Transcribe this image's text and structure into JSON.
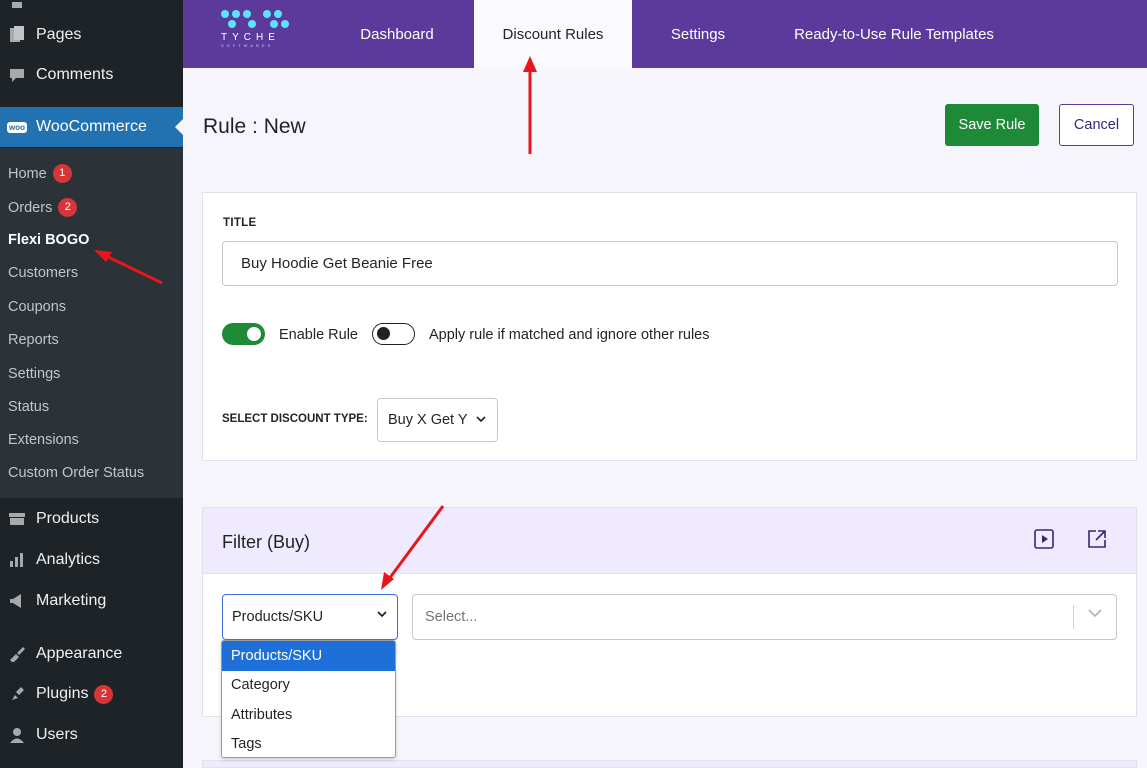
{
  "sidebar": {
    "menu": [
      {
        "label": "Pages",
        "icon": "pages-icon"
      },
      {
        "label": "Comments",
        "icon": "comments-icon"
      },
      {
        "label": "WooCommerce",
        "icon": "woocommerce-icon",
        "icon_text": "woo"
      },
      {
        "label": "Products",
        "icon": "products-icon"
      },
      {
        "label": "Analytics",
        "icon": "analytics-icon"
      },
      {
        "label": "Marketing",
        "icon": "marketing-icon"
      },
      {
        "label": "Appearance",
        "icon": "appearance-icon"
      },
      {
        "label": "Plugins",
        "icon": "plugins-icon",
        "badge": "2"
      },
      {
        "label": "Users",
        "icon": "users-icon"
      }
    ],
    "submenu": [
      {
        "label": "Home",
        "badge": "1"
      },
      {
        "label": "Orders",
        "badge": "2"
      },
      {
        "label": "Flexi BOGO"
      },
      {
        "label": "Customers"
      },
      {
        "label": "Coupons"
      },
      {
        "label": "Reports"
      },
      {
        "label": "Settings"
      },
      {
        "label": "Status"
      },
      {
        "label": "Extensions"
      },
      {
        "label": "Custom Order Status"
      }
    ]
  },
  "topbar": {
    "logo_text": "TYCHE",
    "logo_sub": "SOFTWARES",
    "tabs": [
      {
        "label": "Dashboard"
      },
      {
        "label": "Discount Rules",
        "active": true
      },
      {
        "label": "Settings"
      },
      {
        "label": "Ready-to-Use Rule Templates"
      }
    ]
  },
  "header": {
    "title": "Rule : New",
    "save_label": "Save Rule",
    "cancel_label": "Cancel"
  },
  "rule": {
    "title_label": "TITLE",
    "title_value": "Buy Hoodie Get Beanie Free",
    "enable_label": "Enable Rule",
    "enable_on": true,
    "exclusive_label": "Apply rule if matched and ignore other rules",
    "exclusive_on": false,
    "discount_type_label": "SELECT DISCOUNT TYPE:",
    "discount_type_value": "Buy X Get Y"
  },
  "filter": {
    "title": "Filter (Buy)",
    "type_value": "Products/SKU",
    "value_placeholder": "Select...",
    "options": [
      "Products/SKU",
      "Category",
      "Attributes",
      "Tags"
    ]
  },
  "colors": {
    "brand_purple": "#5b3a9c",
    "save_green": "#1e8a38",
    "wp_sidebar": "#1d2327",
    "wp_active_blue": "#2271b1",
    "annotation_red": "#e8161b"
  }
}
